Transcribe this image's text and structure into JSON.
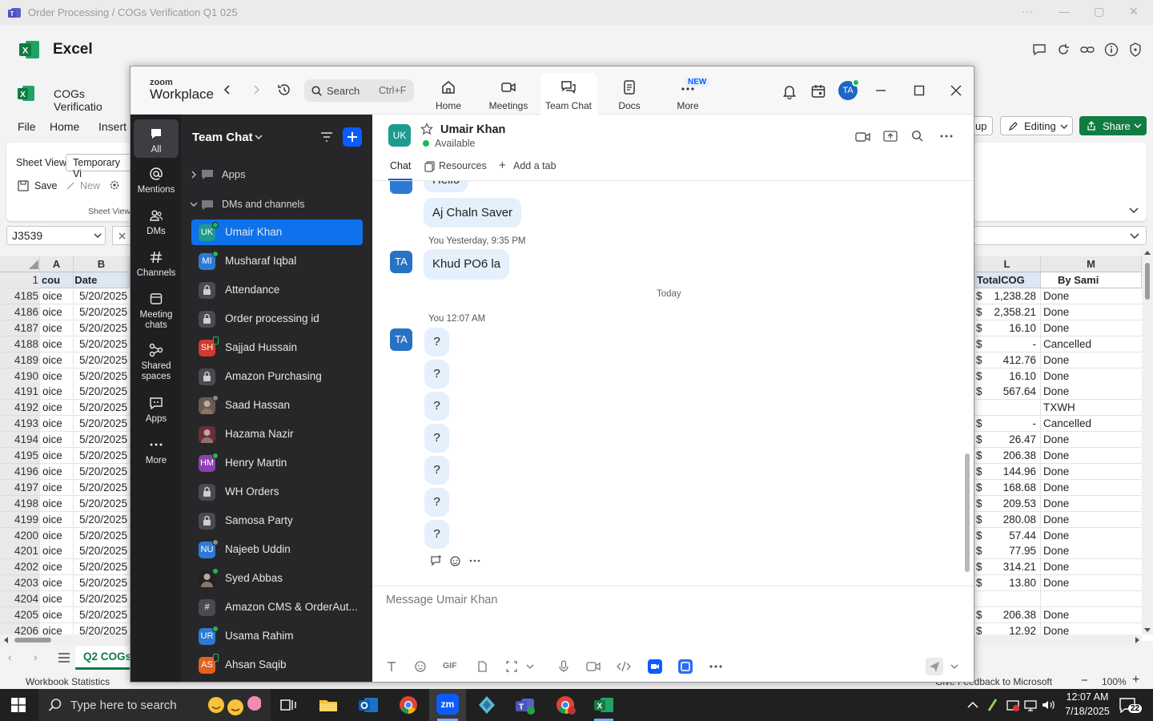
{
  "teams_bar": {
    "title": "Order Processing / COGs Verification Q1 025",
    "more": "···",
    "min": "—",
    "max": "▢",
    "close": "✕"
  },
  "excel": {
    "app_name": "Excel",
    "workbook_title": "COGs Verificatio",
    "menu": [
      "File",
      "Home",
      "Insert"
    ],
    "sheet_view_label": "Sheet View",
    "sheet_view_value": "Temporary Vi",
    "save": "Save",
    "new": "New",
    "group_label": "Sheet View",
    "share_button": "Share",
    "editing_button": "Editing",
    "up_button": "up",
    "name_box": "J3539",
    "columns": {
      "A": "A",
      "B": "B",
      "L": "L",
      "M": "M"
    },
    "header_row_num": "1",
    "header_A": "cou",
    "header_B": "Date",
    "header_L": "TotalCOG",
    "header_M": "By Sami",
    "rows": [
      {
        "n": "4185",
        "a": "oice",
        "b": "5/20/2025",
        "d": "$",
        "l": "1,238.28",
        "m": "Done"
      },
      {
        "n": "4186",
        "a": "oice",
        "b": "5/20/2025",
        "d": "$",
        "l": "2,358.21",
        "m": "Done"
      },
      {
        "n": "4187",
        "a": "oice",
        "b": "5/20/2025",
        "d": "$",
        "l": "16.10",
        "m": "Done"
      },
      {
        "n": "4188",
        "a": "oice",
        "b": "5/20/2025",
        "d": "$",
        "l": "-",
        "m": "Cancelled"
      },
      {
        "n": "4189",
        "a": "oice",
        "b": "5/20/2025",
        "d": "$",
        "l": "412.76",
        "m": "Done"
      },
      {
        "n": "4190",
        "a": "oice",
        "b": "5/20/2025",
        "d": "$",
        "l": "16.10",
        "m": "Done"
      },
      {
        "n": "4191",
        "a": "oice",
        "b": "5/20/2025",
        "d": "$",
        "l": "567.64",
        "m": "Done"
      },
      {
        "n": "4192",
        "a": "oice",
        "b": "5/20/2025",
        "d": "",
        "l": "",
        "m": "TXWH"
      },
      {
        "n": "4193",
        "a": "oice",
        "b": "5/20/2025",
        "d": "$",
        "l": "-",
        "m": "Cancelled"
      },
      {
        "n": "4194",
        "a": "oice",
        "b": "5/20/2025",
        "d": "$",
        "l": "26.47",
        "m": "Done"
      },
      {
        "n": "4195",
        "a": "oice",
        "b": "5/20/2025",
        "d": "$",
        "l": "206.38",
        "m": "Done"
      },
      {
        "n": "4196",
        "a": "oice",
        "b": "5/20/2025",
        "d": "$",
        "l": "144.96",
        "m": "Done"
      },
      {
        "n": "4197",
        "a": "oice",
        "b": "5/20/2025",
        "d": "$",
        "l": "168.68",
        "m": "Done"
      },
      {
        "n": "4198",
        "a": "oice",
        "b": "5/20/2025",
        "d": "$",
        "l": "209.53",
        "m": "Done"
      },
      {
        "n": "4199",
        "a": "oice",
        "b": "5/20/2025",
        "d": "$",
        "l": "280.08",
        "m": "Done"
      },
      {
        "n": "4200",
        "a": "oice",
        "b": "5/20/2025",
        "d": "$",
        "l": "57.44",
        "m": "Done"
      },
      {
        "n": "4201",
        "a": "oice",
        "b": "5/20/2025",
        "d": "$",
        "l": "77.95",
        "m": "Done"
      },
      {
        "n": "4202",
        "a": "oice",
        "b": "5/20/2025",
        "d": "$",
        "l": "314.21",
        "m": "Done"
      },
      {
        "n": "4203",
        "a": "oice",
        "b": "5/20/2025",
        "d": "$",
        "l": "13.80",
        "m": "Done"
      },
      {
        "n": "4204",
        "a": "oice",
        "b": "5/20/2025",
        "d": "",
        "l": "",
        "m": ""
      },
      {
        "n": "4205",
        "a": "oice",
        "b": "5/20/2025",
        "d": "$",
        "l": "206.38",
        "m": "Done"
      },
      {
        "n": "4206",
        "a": "oice",
        "b": "5/20/2025",
        "d": "$",
        "l": "12.92",
        "m": "Done"
      }
    ],
    "sheet_tab": "Q2 COGs",
    "status_left": "Workbook Statistics",
    "status_feedback": "Give Feedback to Microsoft",
    "zoom_level": "100%"
  },
  "zoom": {
    "brand_top": "zoom",
    "brand_bottom": "Workplace",
    "search_placeholder": "Search",
    "search_shortcut": "Ctrl+F",
    "tabs": [
      {
        "label": "Home",
        "icon": "home-icon"
      },
      {
        "label": "Meetings",
        "icon": "video-icon"
      },
      {
        "label": "Team Chat",
        "icon": "chat-icon"
      },
      {
        "label": "Docs",
        "icon": "docs-icon"
      },
      {
        "label": "More",
        "icon": "more-icon"
      }
    ],
    "new_badge": "NEW",
    "avatar": "TA",
    "rail": [
      {
        "label": "All",
        "icon": "chat-bubble-icon"
      },
      {
        "label": "Mentions",
        "icon": "at-icon"
      },
      {
        "label": "DMs",
        "icon": "people-icon"
      },
      {
        "label": "Channels",
        "icon": "hash-icon"
      },
      {
        "label": "Meeting chats",
        "icon": "calendar-icon"
      },
      {
        "label": "Shared spaces",
        "icon": "share-icon"
      },
      {
        "label": "Apps",
        "icon": "apps-icon"
      },
      {
        "label": "More",
        "icon": "ellipsis-icon"
      }
    ],
    "list_title": "Team Chat",
    "apps_section": "Apps",
    "dms_section": "DMs and channels",
    "contacts": [
      {
        "initials": "UK",
        "name": "Umair Khan",
        "color": "#1d9b8e",
        "status": "online",
        "selected": true
      },
      {
        "initials": "MI",
        "name": "Musharaf Iqbal",
        "color": "#2d7ad6",
        "status": "online"
      },
      {
        "initials": "",
        "name": "Attendance",
        "color": "#4a4a4f",
        "kind": "lock"
      },
      {
        "initials": "",
        "name": "Order processing id",
        "color": "#4a4a4f",
        "kind": "lock"
      },
      {
        "initials": "SH",
        "name": "Sajjad Hussain",
        "color": "#d03a2f",
        "status": "mobile"
      },
      {
        "initials": "",
        "name": "Amazon Purchasing",
        "color": "#4a4a4f",
        "kind": "lock"
      },
      {
        "initials": "",
        "name": "Saad Hassan",
        "color": "#6b5a50",
        "status": "offline",
        "kind": "photo"
      },
      {
        "initials": "",
        "name": "Hazama Nazir",
        "color": "#6b2e3a",
        "kind": "photo"
      },
      {
        "initials": "HM",
        "name": "Henry Martin",
        "color": "#8c3fb0",
        "status": "online"
      },
      {
        "initials": "",
        "name": "WH Orders",
        "color": "#4a4a4f",
        "kind": "lock"
      },
      {
        "initials": "",
        "name": "Samosa Party",
        "color": "#4a4a4f",
        "kind": "lock"
      },
      {
        "initials": "NU",
        "name": "Najeeb Uddin",
        "color": "#2d7ad6",
        "status": "offline"
      },
      {
        "initials": "",
        "name": "Syed Abbas",
        "color": "#222",
        "status": "online",
        "kind": "photo"
      },
      {
        "initials": "#",
        "name": "Amazon CMS & OrderAut...",
        "color": "#4a4a4f",
        "kind": "hash"
      },
      {
        "initials": "UR",
        "name": "Usama Rahim",
        "color": "#2d7ad6",
        "status": "online"
      },
      {
        "initials": "AS",
        "name": "Ahsan Saqib",
        "color": "#e0611d",
        "status": "mobile"
      }
    ],
    "chat_header": {
      "initials": "UK",
      "name": "Umair Khan",
      "status": "Available"
    },
    "chat_tabs": [
      "Chat",
      "Resources",
      "Add a tab"
    ],
    "messages": {
      "partial": "Hello",
      "m1": "Aj Chaln Saver",
      "meta2_sender": "You",
      "meta2_time": "Yesterday, 9:35 PM",
      "m2": "Khud PO6 la",
      "divider": "Today",
      "meta3_sender": "You",
      "meta3_time": "12:07 AM",
      "q": [
        "?",
        "?",
        "?",
        "?",
        "?",
        "?",
        "?"
      ]
    },
    "avatar_you": "TA",
    "composer_placeholder": "Message Umair Khan",
    "gif": "GIF"
  },
  "taskbar": {
    "search_placeholder": "Type here to search",
    "time": "12:07 AM",
    "date": "7/18/2025",
    "notifications": "22"
  }
}
